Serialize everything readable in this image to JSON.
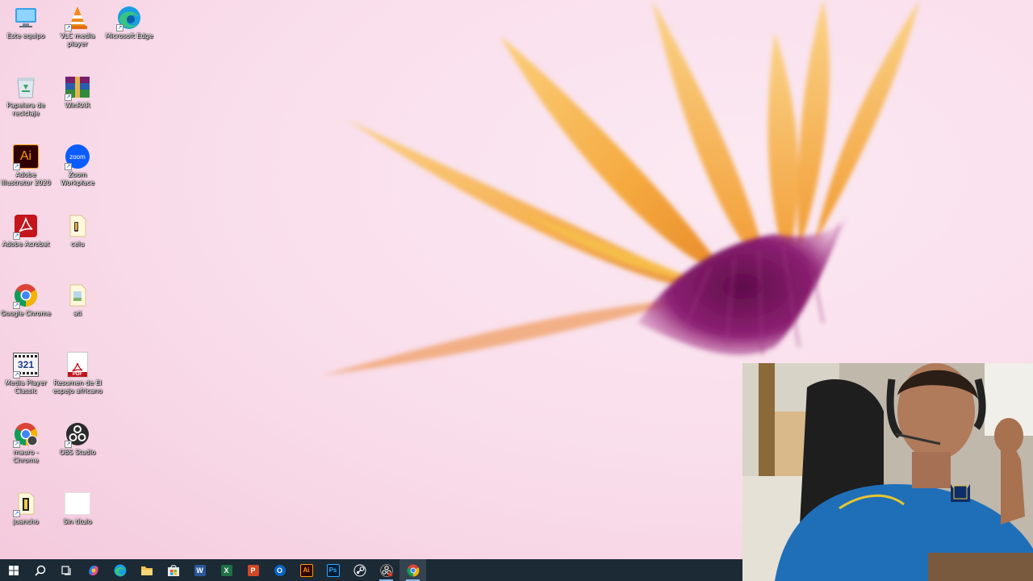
{
  "desktop": {
    "icons": [
      {
        "label": "Este equipo",
        "icon": "computer-icon"
      },
      {
        "label": "VLC media player",
        "icon": "vlc-icon"
      },
      {
        "label": "Microsoft Edge",
        "icon": "edge-icon"
      },
      {
        "label": "Papelera de reciclaje",
        "icon": "recycle-bin-icon"
      },
      {
        "label": "WinRAR",
        "icon": "winrar-icon"
      },
      {
        "label": "Adobe Illustrator 2020",
        "icon": "illustrator-icon"
      },
      {
        "label": "Zoom Workplace",
        "icon": "zoom-icon"
      },
      {
        "label": "Adobe Acrobat",
        "icon": "acrobat-icon"
      },
      {
        "label": "celu",
        "icon": "folder-icon"
      },
      {
        "label": "Google Chrome",
        "icon": "chrome-icon"
      },
      {
        "label": "ati",
        "icon": "folder-icon"
      },
      {
        "label": "Media Player Classic",
        "icon": "mpc-icon"
      },
      {
        "label": "Resumen de El espejo africano",
        "icon": "pdf-icon"
      },
      {
        "label": "mauro - Chrome",
        "icon": "chrome-profile-icon"
      },
      {
        "label": "OBS Studio",
        "icon": "obs-icon"
      },
      {
        "label": "juancho",
        "icon": "folder-icon"
      },
      {
        "label": "Sin título",
        "icon": "blank-file-icon"
      }
    ],
    "zoom_icon_text": "zoom",
    "illustrator_icon_text": "Ai",
    "mpc_icon_text": "321",
    "pdf_icon_text": "PDF"
  },
  "taskbar": {
    "items": [
      {
        "name": "start",
        "icon": "windows-start-icon"
      },
      {
        "name": "search",
        "icon": "search-icon"
      },
      {
        "name": "task-view",
        "icon": "task-view-icon"
      },
      {
        "name": "copilot",
        "icon": "copilot-icon"
      },
      {
        "name": "edge",
        "icon": "edge-icon"
      },
      {
        "name": "file-explorer",
        "icon": "folder-icon"
      },
      {
        "name": "store",
        "icon": "store-icon"
      },
      {
        "name": "word",
        "icon": "word-icon",
        "text": "W"
      },
      {
        "name": "excel",
        "icon": "excel-icon",
        "text": "X"
      },
      {
        "name": "powerpoint",
        "icon": "powerpoint-icon",
        "text": "P"
      },
      {
        "name": "outlook",
        "icon": "outlook-icon",
        "text": "O"
      },
      {
        "name": "illustrator",
        "icon": "illustrator-icon",
        "text": "Ai"
      },
      {
        "name": "photoshop",
        "icon": "photoshop-icon",
        "text": "Ps"
      },
      {
        "name": "steam",
        "icon": "steam-icon"
      },
      {
        "name": "obs",
        "icon": "obs-icon"
      },
      {
        "name": "chrome",
        "icon": "chrome-icon"
      }
    ]
  },
  "colors": {
    "taskbar": "#1c2a35",
    "petal": "#f6b24a",
    "flower_center": "#8a1f6e",
    "wallpaper": "#f9dcea"
  }
}
